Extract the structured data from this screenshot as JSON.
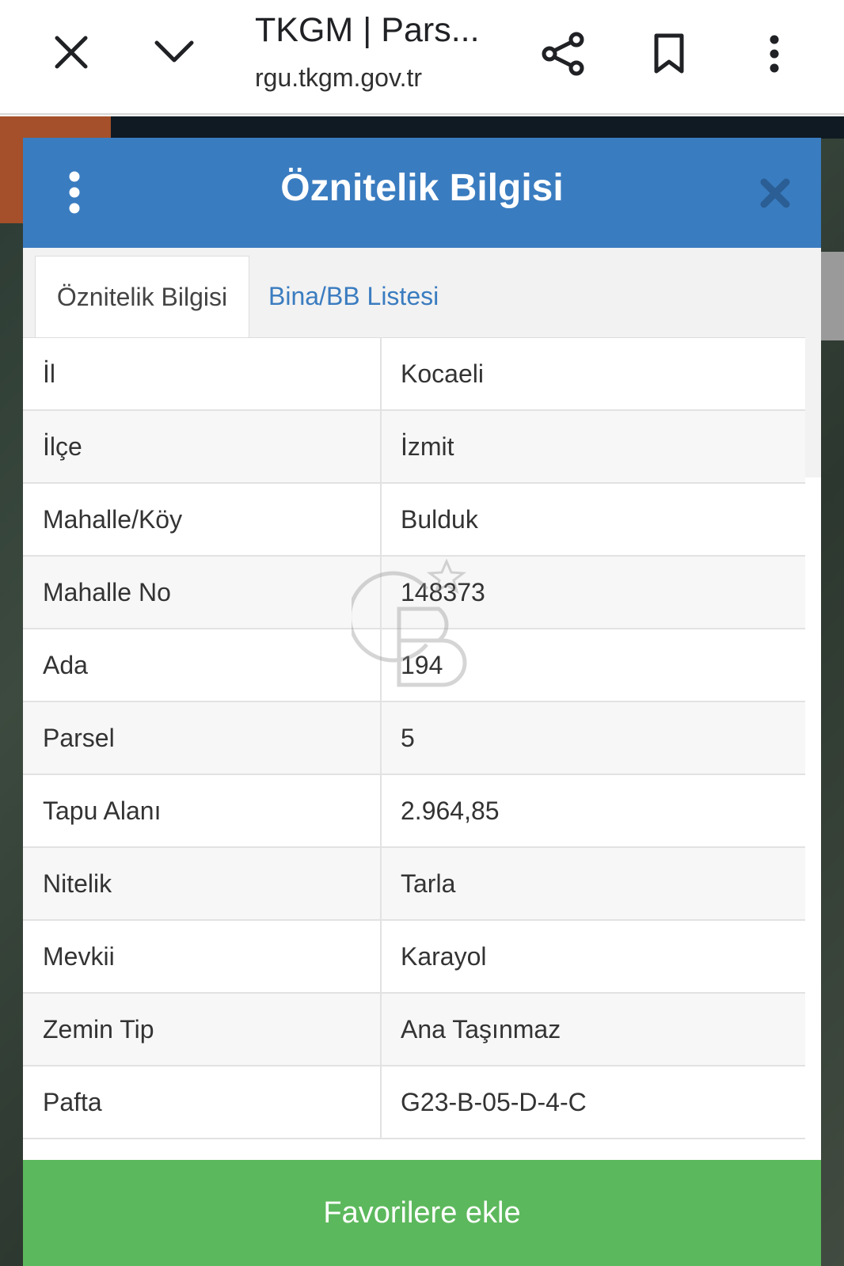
{
  "browser": {
    "title": "TKGM | Pars...",
    "url": "rgu.tkgm.gov.tr"
  },
  "dialog": {
    "title": "Öznitelik Bilgisi",
    "header_color": "#3a7cc0"
  },
  "tabs": [
    {
      "label": "Öznitelik Bilgisi",
      "active": true
    },
    {
      "label": "Bina/BB Listesi",
      "active": false
    }
  ],
  "attributes": [
    {
      "key": "İl",
      "value": "Kocaeli"
    },
    {
      "key": "İlçe",
      "value": "İzmit"
    },
    {
      "key": "Mahalle/Köy",
      "value": "Bulduk"
    },
    {
      "key": "Mahalle No",
      "value": "148373"
    },
    {
      "key": "Ada",
      "value": "194"
    },
    {
      "key": "Parsel",
      "value": "5"
    },
    {
      "key": "Tapu Alanı",
      "value": "2.964,85"
    },
    {
      "key": "Nitelik",
      "value": "Tarla"
    },
    {
      "key": "Mevkii",
      "value": "Karayol"
    },
    {
      "key": "Zemin Tip",
      "value": "Ana Taşınmaz"
    },
    {
      "key": "Pafta",
      "value": "G23-B-05-D-4-C"
    }
  ],
  "actions": {
    "favorites_label": "Favorilere ekle",
    "favorites_color": "#5cb85c"
  },
  "icons": {
    "close": "close-icon",
    "collapse": "chevron-down-icon",
    "share": "share-icon",
    "bookmark": "bookmark-icon",
    "more": "more-vert-icon",
    "dialog_menu": "more-vert-icon",
    "dialog_close": "close-icon"
  }
}
